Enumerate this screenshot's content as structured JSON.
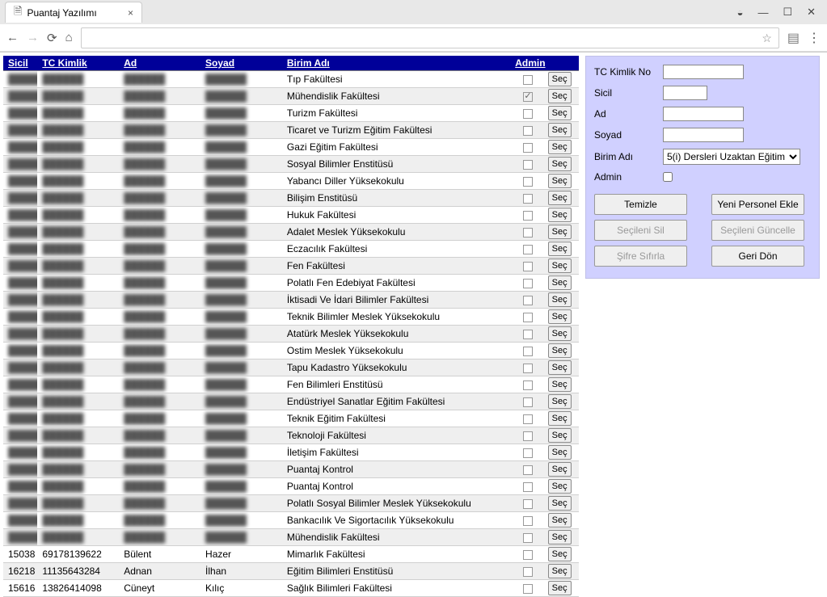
{
  "browser": {
    "tab_title": "Puantaj Yazılımı",
    "address": ""
  },
  "table": {
    "headers": {
      "sicil": "Sicil",
      "tc": "TC Kimlik",
      "ad": "Ad",
      "soyad": "Soyad",
      "birim": "Birim Adı",
      "admin": "Admin"
    },
    "select_label": "Seç",
    "rows": [
      {
        "sicil": "",
        "tc": "",
        "ad": "",
        "soyad": "",
        "birim": "Tıp Fakültesi",
        "admin": false,
        "blurred": true
      },
      {
        "sicil": "",
        "tc": "",
        "ad": "",
        "soyad": "",
        "birim": "Mühendislik Fakültesi",
        "admin": "maybe",
        "blurred": true
      },
      {
        "sicil": "",
        "tc": "",
        "ad": "",
        "soyad": "",
        "birim": "Turizm Fakültesi",
        "admin": false,
        "blurred": true
      },
      {
        "sicil": "",
        "tc": "",
        "ad": "",
        "soyad": "",
        "birim": "Ticaret ve Turizm Eğitim Fakültesi",
        "admin": false,
        "blurred": true
      },
      {
        "sicil": "",
        "tc": "",
        "ad": "",
        "soyad": "",
        "birim": "Gazi Eğitim Fakültesi",
        "admin": false,
        "blurred": true
      },
      {
        "sicil": "",
        "tc": "",
        "ad": "",
        "soyad": "",
        "birim": "Sosyal Bilimler Enstitüsü",
        "admin": false,
        "blurred": true
      },
      {
        "sicil": "",
        "tc": "",
        "ad": "",
        "soyad": "",
        "birim": "Yabancı Diller Yüksekokulu",
        "admin": false,
        "blurred": true
      },
      {
        "sicil": "",
        "tc": "",
        "ad": "",
        "soyad": "",
        "birim": "Bilişim Enstitüsü",
        "admin": false,
        "blurred": true
      },
      {
        "sicil": "",
        "tc": "",
        "ad": "",
        "soyad": "",
        "birim": "Hukuk Fakültesi",
        "admin": false,
        "blurred": true
      },
      {
        "sicil": "",
        "tc": "",
        "ad": "",
        "soyad": "",
        "birim": "Adalet Meslek Yüksekokulu",
        "admin": false,
        "blurred": true
      },
      {
        "sicil": "",
        "tc": "",
        "ad": "",
        "soyad": "",
        "birim": "Eczacılık Fakültesi",
        "admin": false,
        "blurred": true
      },
      {
        "sicil": "",
        "tc": "",
        "ad": "",
        "soyad": "",
        "birim": "Fen Fakültesi",
        "admin": false,
        "blurred": true
      },
      {
        "sicil": "",
        "tc": "",
        "ad": "",
        "soyad": "",
        "birim": "Polatlı Fen Edebiyat Fakültesi",
        "admin": false,
        "blurred": true
      },
      {
        "sicil": "",
        "tc": "",
        "ad": "",
        "soyad": "",
        "birim": "İktisadi Ve İdari Bilimler Fakültesi",
        "admin": false,
        "blurred": true
      },
      {
        "sicil": "",
        "tc": "",
        "ad": "",
        "soyad": "",
        "birim": "Teknik Bilimler Meslek Yüksekokulu",
        "admin": false,
        "blurred": true
      },
      {
        "sicil": "",
        "tc": "",
        "ad": "",
        "soyad": "",
        "birim": "Atatürk Meslek Yüksekokulu",
        "admin": false,
        "blurred": true
      },
      {
        "sicil": "",
        "tc": "",
        "ad": "",
        "soyad": "",
        "birim": "Ostim Meslek Yüksekokulu",
        "admin": false,
        "blurred": true
      },
      {
        "sicil": "",
        "tc": "",
        "ad": "",
        "soyad": "",
        "birim": "Tapu Kadastro Yüksekokulu",
        "admin": false,
        "blurred": true
      },
      {
        "sicil": "",
        "tc": "",
        "ad": "",
        "soyad": "",
        "birim": "Fen Bilimleri Enstitüsü",
        "admin": false,
        "blurred": true
      },
      {
        "sicil": "",
        "tc": "",
        "ad": "",
        "soyad": "",
        "birim": "Endüstriyel Sanatlar Eğitim Fakültesi",
        "admin": false,
        "blurred": true
      },
      {
        "sicil": "",
        "tc": "",
        "ad": "",
        "soyad": "",
        "birim": "Teknik Eğitim Fakültesi",
        "admin": false,
        "blurred": true
      },
      {
        "sicil": "",
        "tc": "",
        "ad": "",
        "soyad": "",
        "birim": "Teknoloji Fakültesi",
        "admin": false,
        "blurred": true
      },
      {
        "sicil": "",
        "tc": "",
        "ad": "",
        "soyad": "",
        "birim": "İletişim Fakültesi",
        "admin": false,
        "blurred": true
      },
      {
        "sicil": "",
        "tc": "",
        "ad": "",
        "soyad": "",
        "birim": "Puantaj Kontrol",
        "admin": false,
        "blurred": true
      },
      {
        "sicil": "",
        "tc": "",
        "ad": "",
        "soyad": "",
        "birim": "Puantaj Kontrol",
        "admin": false,
        "blurred": true
      },
      {
        "sicil": "",
        "tc": "",
        "ad": "",
        "soyad": "",
        "birim": "Polatlı Sosyal Bilimler Meslek Yüksekokulu",
        "admin": false,
        "blurred": true
      },
      {
        "sicil": "",
        "tc": "",
        "ad": "",
        "soyad": "",
        "birim": "Bankacılık Ve Sigortacılık Yüksekokulu",
        "admin": false,
        "blurred": true
      },
      {
        "sicil": "",
        "tc": "",
        "ad": "",
        "soyad": "",
        "birim": "Mühendislik Fakültesi",
        "admin": false,
        "blurred": true
      },
      {
        "sicil": "15038",
        "tc": "69178139622",
        "ad": "Bülent",
        "soyad": "Hazer",
        "birim": "Mimarlık Fakültesi",
        "admin": false,
        "blurred": false
      },
      {
        "sicil": "16218",
        "tc": "11135643284",
        "ad": "Adnan",
        "soyad": "İlhan",
        "birim": "Eğitim Bilimleri Enstitüsü",
        "admin": false,
        "blurred": false
      },
      {
        "sicil": "15616",
        "tc": "13826414098",
        "ad": "Cüneyt",
        "soyad": "Kılıç",
        "birim": "Sağlık Bilimleri Fakültesi",
        "admin": false,
        "blurred": false
      }
    ]
  },
  "form": {
    "labels": {
      "tc": "TC Kimlik No",
      "sicil": "Sicil",
      "ad": "Ad",
      "soyad": "Soyad",
      "birim": "Birim Adı",
      "admin": "Admin"
    },
    "values": {
      "tc": "",
      "sicil": "",
      "ad": "",
      "soyad": "",
      "birim": "5(i) Dersleri Uzaktan Eğitim",
      "admin": false
    },
    "buttons": {
      "temizle": "Temizle",
      "yeni": "Yeni Personel Ekle",
      "sil": "Seçileni Sil",
      "guncelle": "Seçileni Güncelle",
      "sifre": "Şifre Sıfırla",
      "geri": "Geri Dön"
    }
  }
}
